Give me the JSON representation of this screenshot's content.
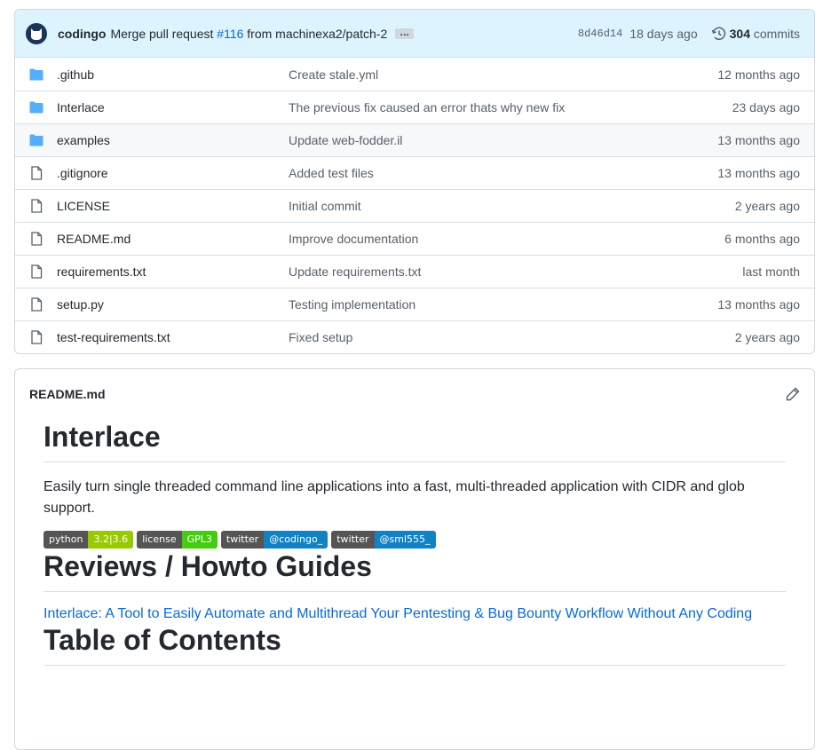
{
  "commit": {
    "author": "codingo",
    "message": "Merge pull request",
    "pr": "#116",
    "branch_text": "from machinexa2/patch-2",
    "ellipsis": "…",
    "sha": "8d46d14",
    "age": "18 days ago",
    "count": "304",
    "count_label": "commits"
  },
  "files": [
    {
      "type": "folder",
      "name": ".github",
      "message": "Create stale.yml",
      "age": "12 months ago"
    },
    {
      "type": "folder",
      "name": "Interlace",
      "message": "The previous fix caused an error thats why new fix",
      "age": "23 days ago"
    },
    {
      "type": "folder",
      "name": "examples",
      "message": "Update web-fodder.il",
      "age": "13 months ago"
    },
    {
      "type": "file",
      "name": ".gitignore",
      "message": "Added test files",
      "age": "13 months ago"
    },
    {
      "type": "file",
      "name": "LICENSE",
      "message": "Initial commit",
      "age": "2 years ago"
    },
    {
      "type": "file",
      "name": "README.md",
      "message": "Improve documentation",
      "age": "6 months ago"
    },
    {
      "type": "file",
      "name": "requirements.txt",
      "message": "Update requirements.txt",
      "age": "last month"
    },
    {
      "type": "file",
      "name": "setup.py",
      "message": "Testing implementation",
      "age": "13 months ago"
    },
    {
      "type": "file",
      "name": "test-requirements.txt",
      "message": "Fixed setup",
      "age": "2 years ago"
    }
  ],
  "readme": {
    "filename": "README.md",
    "h1": "Interlace",
    "description": "Easily turn single threaded command line applications into a fast, multi-threaded application with CIDR and glob support.",
    "badges": [
      {
        "left": "python",
        "right": "3.2|3.6",
        "color": "#97ca00"
      },
      {
        "left": "license",
        "right": "GPL3",
        "color": "#4c1"
      },
      {
        "left": "twitter",
        "right": "@codingo_",
        "color": "#1182c3"
      },
      {
        "left": "twitter",
        "right": "@sml555_",
        "color": "#1182c3"
      }
    ],
    "h2": "Reviews / Howto Guides",
    "link": "Interlace: A Tool to Easily Automate and Multithread Your Pentesting & Bug Bounty Workflow Without Any Coding",
    "h3": "Table of Contents"
  },
  "colors": {
    "folder": "#54aeff",
    "link": "#0969da"
  }
}
